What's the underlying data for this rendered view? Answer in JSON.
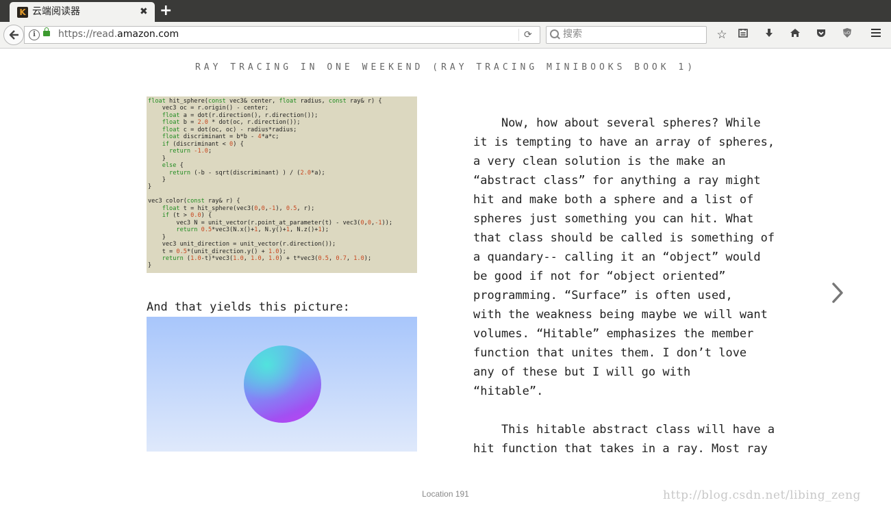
{
  "browser": {
    "tab_title": "云端阅读器",
    "tab_favicon_letter": "K",
    "tab_close": "✖",
    "new_tab": "+",
    "url_prefix": "https://read.",
    "url_host": "amazon.com",
    "search_placeholder": "搜索",
    "icons": [
      "back-icon",
      "info-icon",
      "lock-icon",
      "reload-icon",
      "search-icon",
      "bookmark-star-icon",
      "reading-list-icon",
      "download-icon",
      "home-icon",
      "pocket-icon",
      "ublock-icon",
      "menu-icon"
    ]
  },
  "reader": {
    "book_title": "RAY TRACING IN ONE WEEKEND (RAY TRACING MINIBOOKS BOOK 1)",
    "caption": "And that yields this picture:",
    "location": "Location 191",
    "watermark": "http://blog.csdn.net/libing_zeng",
    "paragraph1": [
      "    Now, how about several spheres? While",
      "it is tempting to have an array of spheres,",
      "a very clean solution is the make an",
      "“abstract class” for anything a ray might",
      "hit and make both a sphere and a list of",
      "spheres just something you can hit. What",
      "that class should be called is something of",
      "a quandary-- calling it an “object” would",
      "be good if not for “object oriented”",
      "programming. “Surface” is often used,",
      "with the weakness being maybe we will want",
      "volumes. “Hitable” emphasizes the member",
      "function that unites them. I don’t love",
      "any of these but I will go with",
      "“hitable”."
    ],
    "paragraph2": [
      "    This hitable abstract class will have a",
      "hit function that takes in a ray. Most ray"
    ]
  },
  "colors": {
    "code_background": "#dcd8c0",
    "keyword": "#1e8b1e",
    "number": "#c8461e",
    "sky_top": "#a8c6fb",
    "sky_bottom": "#dfe9fb"
  }
}
